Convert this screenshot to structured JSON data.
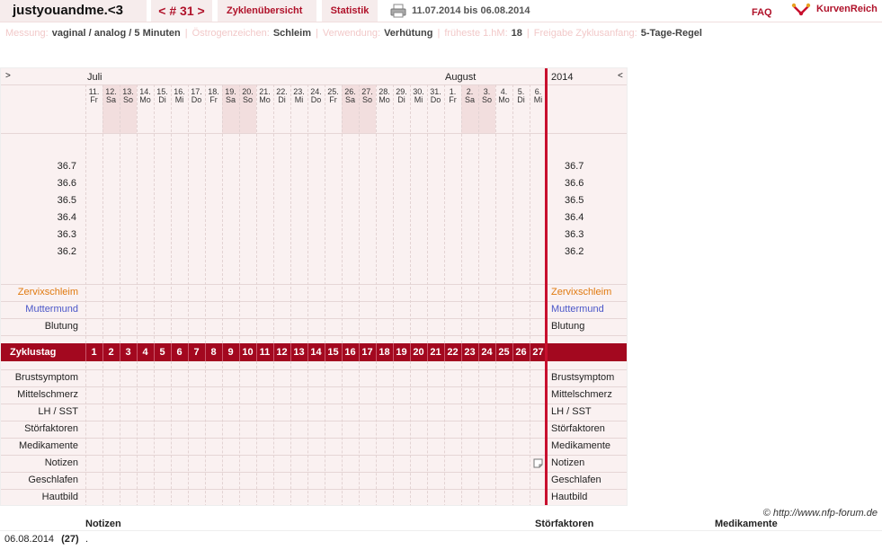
{
  "header": {
    "title": "justyouandme.<3",
    "cycle_nav": "< # 31 >",
    "tab_overview": "Zyklenübersicht",
    "tab_stats": "Statistik",
    "date_range": "11.07.2014 bis 06.08.2014",
    "faq": "FAQ",
    "logo_text": "KurvenReich",
    "print_icon": "printer-icon",
    "logo_icon": "kurvenreich-logo-icon"
  },
  "settings": [
    {
      "label": "Messung:",
      "value": "vaginal / analog / 5 Minuten"
    },
    {
      "label": "Östrogenzeichen:",
      "value": "Schleim"
    },
    {
      "label": "Verwendung:",
      "value": "Verhütung"
    },
    {
      "label": "früheste 1.hM:",
      "value": "18"
    },
    {
      "label": "Freigabe Zyklusanfang:",
      "value": "5-Tage-Regel"
    }
  ],
  "chart": {
    "nav_left": ">",
    "nav_right": "<",
    "month_left": "Juli",
    "month_right": "August",
    "year": "2014",
    "days": [
      {
        "num": "11.",
        "name": "Fr",
        "weekend": false
      },
      {
        "num": "12.",
        "name": "Sa",
        "weekend": true
      },
      {
        "num": "13.",
        "name": "So",
        "weekend": true
      },
      {
        "num": "14.",
        "name": "Mo",
        "weekend": false
      },
      {
        "num": "15.",
        "name": "Di",
        "weekend": false
      },
      {
        "num": "16.",
        "name": "Mi",
        "weekend": false
      },
      {
        "num": "17.",
        "name": "Do",
        "weekend": false
      },
      {
        "num": "18.",
        "name": "Fr",
        "weekend": false
      },
      {
        "num": "19.",
        "name": "Sa",
        "weekend": true
      },
      {
        "num": "20.",
        "name": "So",
        "weekend": true
      },
      {
        "num": "21.",
        "name": "Mo",
        "weekend": false
      },
      {
        "num": "22.",
        "name": "Di",
        "weekend": false
      },
      {
        "num": "23.",
        "name": "Mi",
        "weekend": false
      },
      {
        "num": "24.",
        "name": "Do",
        "weekend": false
      },
      {
        "num": "25.",
        "name": "Fr",
        "weekend": false
      },
      {
        "num": "26.",
        "name": "Sa",
        "weekend": true
      },
      {
        "num": "27.",
        "name": "So",
        "weekend": true
      },
      {
        "num": "28.",
        "name": "Mo",
        "weekend": false
      },
      {
        "num": "29.",
        "name": "Di",
        "weekend": false
      },
      {
        "num": "30.",
        "name": "Mi",
        "weekend": false
      },
      {
        "num": "31.",
        "name": "Do",
        "weekend": false
      },
      {
        "num": "1.",
        "name": "Fr",
        "weekend": false
      },
      {
        "num": "2.",
        "name": "Sa",
        "weekend": true
      },
      {
        "num": "3.",
        "name": "So",
        "weekend": true
      },
      {
        "num": "4.",
        "name": "Mo",
        "weekend": false
      },
      {
        "num": "5.",
        "name": "Di",
        "weekend": false
      },
      {
        "num": "6.",
        "name": "Mi",
        "weekend": false
      }
    ],
    "temperatures": [
      "36.7",
      "36.6",
      "36.5",
      "36.4",
      "36.3",
      "36.2"
    ],
    "rows_upper": [
      "Zervixschleim",
      "Muttermund",
      "Blutung"
    ],
    "cycle_label": "Zyklustag",
    "cycle_days": [
      "1",
      "2",
      "3",
      "4",
      "5",
      "6",
      "7",
      "8",
      "9",
      "10",
      "11",
      "12",
      "13",
      "14",
      "15",
      "16",
      "17",
      "18",
      "19",
      "20",
      "21",
      "22",
      "23",
      "24",
      "25",
      "26",
      "27"
    ],
    "rows_lower": [
      "Brustsymptom",
      "Mittelschmerz",
      "LH / SST",
      "Störfaktoren",
      "Medikamente",
      "Notizen",
      "Geschlafen",
      "Hautbild"
    ],
    "note_icon": "note-icon"
  },
  "footer": {
    "copyright": "© http://www.nfp-forum.de",
    "notes_header": "Notizen",
    "stoerfaktoren_header": "Störfaktoren",
    "medikamente_header": "Medikamente",
    "note_date": "06.08.2014",
    "note_day": "(27)",
    "note_text": "."
  }
}
